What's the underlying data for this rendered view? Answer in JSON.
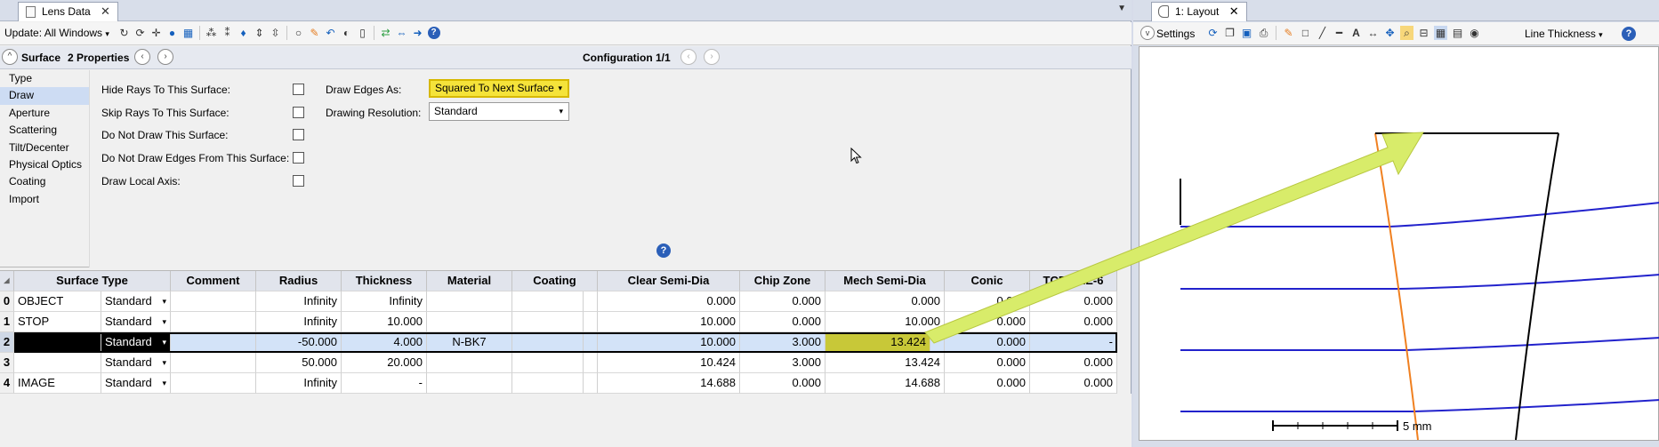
{
  "lens_data_tab": {
    "title": "Lens Data",
    "close": "✕"
  },
  "toolbar": {
    "update_label": "Update: All Windows",
    "update_arrow": "▾"
  },
  "surface_bar": {
    "label": "Surface",
    "properties": "2 Properties",
    "configuration": "Configuration 1/1"
  },
  "nav": [
    "Type",
    "Draw",
    "Aperture",
    "Scattering",
    "Tilt/Decenter",
    "Physical Optics",
    "Coating",
    "Import"
  ],
  "nav_active": "Draw",
  "draw_props": {
    "hide_rays": "Hide Rays To This Surface:",
    "skip_rays": "Skip Rays To This Surface:",
    "no_draw_surface": "Do Not Draw This Surface:",
    "no_draw_edges": "Do Not Draw Edges From This Surface:",
    "draw_local_axis": "Draw Local Axis:",
    "draw_edges_as_label": "Draw Edges As:",
    "draw_edges_as_value": "Squared To Next Surface",
    "drawing_resolution_label": "Drawing Resolution:",
    "drawing_resolution_value": "Standard"
  },
  "table": {
    "headers": [
      "Surface Type",
      "Comment",
      "Radius",
      "Thickness",
      "Material",
      "Coating",
      "Clear Semi-Dia",
      "Chip Zone",
      "Mech Semi-Dia",
      "Conic",
      "TCE x 1E-6"
    ],
    "rows": [
      {
        "num": "0",
        "name": "OBJECT",
        "type": "Standard",
        "comment": "",
        "radius": "Infinity",
        "thickness": "Infinity",
        "material": "",
        "coating": "",
        "clear": "0.000",
        "chip": "0.000",
        "mech": "0.000",
        "conic": "0.000",
        "tce": "0.000"
      },
      {
        "num": "1",
        "name": "STOP",
        "type": "Standard",
        "comment": "",
        "radius": "Infinity",
        "thickness": "10.000",
        "material": "",
        "coating": "",
        "clear": "10.000",
        "chip": "0.000",
        "mech": "10.000",
        "conic": "0.000",
        "tce": "0.000"
      },
      {
        "num": "2",
        "name": "",
        "type": "Standard",
        "comment": "",
        "radius": "-50.000",
        "thickness": "4.000",
        "material": "N-BK7",
        "coating": "",
        "clear": "10.000",
        "chip": "3.000",
        "mech": "13.424",
        "conic": "0.000",
        "tce": "-"
      },
      {
        "num": "3",
        "name": "",
        "type": "Standard",
        "comment": "",
        "radius": "50.000",
        "thickness": "20.000",
        "material": "",
        "coating": "",
        "clear": "10.424",
        "chip": "3.000",
        "mech": "13.424",
        "conic": "0.000",
        "tce": "0.000"
      },
      {
        "num": "4",
        "name": "IMAGE",
        "type": "Standard",
        "comment": "",
        "radius": "Infinity",
        "thickness": "-",
        "material": "",
        "coating": "",
        "clear": "14.688",
        "chip": "0.000",
        "mech": "14.688",
        "conic": "0.000",
        "tce": "0.000"
      }
    ]
  },
  "layout_tab": {
    "title": "1: Layout",
    "close": "✕"
  },
  "layout_toolbar": {
    "settings": "Settings",
    "line_thickness": "Line Thickness"
  },
  "layout": {
    "scale_label": "5 mm"
  },
  "colors": {
    "highlight_yellow": "#f5e33a",
    "arrow_green": "#d8ec6a",
    "ray_blue": "#2222cc",
    "lens_orange": "#f08020",
    "selection_blue": "#d3e3f8"
  }
}
